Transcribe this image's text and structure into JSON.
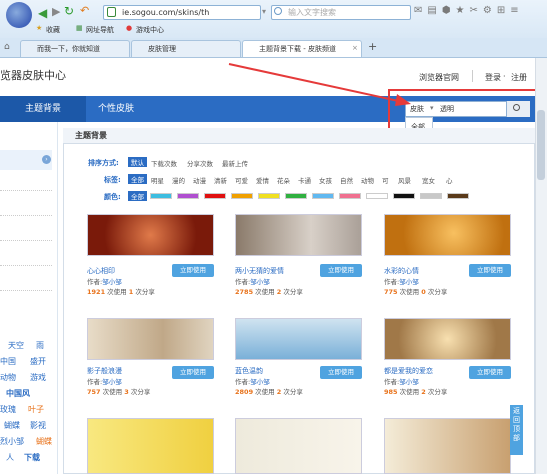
{
  "browser": {
    "url": "ie.sogou.com/skins/th",
    "search_placeholder": "输入文字搜索",
    "bookmarks": [
      "收藏",
      "网址导航",
      "游戏中心"
    ],
    "tabs": [
      "而我一下，你就知道",
      "皮肤管理",
      "主题背景下载 - 皮肤频道"
    ],
    "add_tab": "+"
  },
  "header": {
    "site_title": "览器皮肤中心",
    "official_link": "浏览器官网",
    "login": "登录",
    "separator": "·",
    "register": "注册"
  },
  "nav": [
    "主题背景",
    "个性皮肤"
  ],
  "search": {
    "scope": "皮肤",
    "arrow": "▾",
    "query": "透明",
    "options": [
      "全部",
      "皮肤"
    ]
  },
  "section_title": "主题背景",
  "sort": {
    "label": "排序方式:",
    "options": [
      "默认",
      "下载次数",
      "分享次数",
      "最新上传"
    ]
  },
  "tags": {
    "label": "标签:",
    "options": [
      "全部",
      "明星",
      "漫的",
      "动漫",
      "清新",
      "可爱",
      "爱情",
      "花朵",
      "卡通",
      "女孩",
      "自然",
      "动物",
      "可",
      "风景",
      "宽女",
      "心"
    ]
  },
  "colors": {
    "label": "颜色:",
    "all": "全部",
    "swatches": [
      "#3dbde0",
      "#b04fd0",
      "#e01010",
      "#f0a000",
      "#f0e020",
      "#30b040",
      "#60b8f0",
      "#f07090",
      "#ffffff",
      "#111111",
      "#c8c8c8",
      "#5a3a1a"
    ]
  },
  "cards": [
    {
      "name": "心心相印",
      "author_label": "作者:",
      "author": "邹小邹",
      "downloads": "1921",
      "shares": "1",
      "used_label": "次使用",
      "shared_label": "次分享",
      "button": "立即使用"
    },
    {
      "name": "两小无猜的爱情",
      "author_label": "作者:",
      "author": "邹小邹",
      "downloads": "2785",
      "shares": "2",
      "used_label": "次使用",
      "shared_label": "次分享",
      "button": "立即使用"
    },
    {
      "name": "水彩的心情",
      "author_label": "作者:",
      "author": "邹小邹",
      "downloads": "775",
      "shares": "0",
      "used_label": "次使用",
      "shared_label": "次分享",
      "button": "立即使用"
    },
    {
      "name": "影子般浪漫",
      "author_label": "作者:",
      "author": "邹小邹",
      "downloads": "757",
      "shares": "3",
      "used_label": "次使用",
      "shared_label": "次分享",
      "button": "立即使用"
    },
    {
      "name": "蓝色温韵",
      "author_label": "作者:",
      "author": "邹小邹",
      "downloads": "2809",
      "shares": "2",
      "used_label": "次使用",
      "shared_label": "次分享",
      "button": "立即使用"
    },
    {
      "name": "都是爱我的爱恋",
      "author_label": "作者:",
      "author": "邹小邹",
      "downloads": "985",
      "shares": "2",
      "used_label": "次使用",
      "shared_label": "次分享",
      "button": "立即使用"
    }
  ],
  "left_links": [
    "天空",
    "雨",
    "中国",
    "盛开",
    "动物",
    "游戏",
    "中国风",
    "玫瑰",
    "叶子",
    "蝴蝶",
    "影视",
    "烈小邹",
    "蝴蝶",
    "人",
    "下载"
  ],
  "back_to_top": "返回顶部"
}
